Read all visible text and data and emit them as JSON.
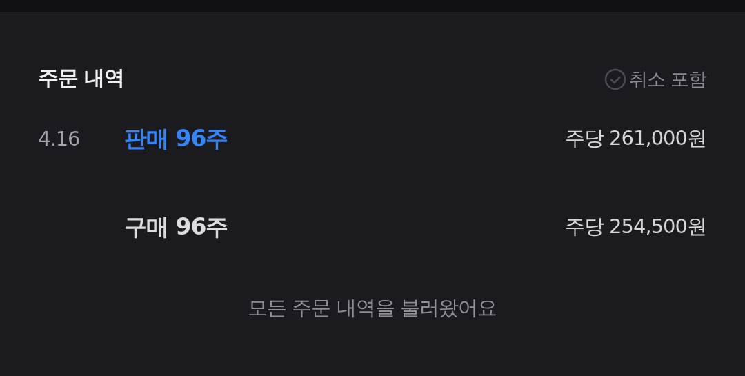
{
  "title": "주문 내역",
  "filter": {
    "label": "취소 포함",
    "checked": false
  },
  "orders": [
    {
      "date": "4.16",
      "kind": "sell",
      "label": "판매 96주",
      "price": "주당 261,000원"
    },
    {
      "kind": "buy",
      "label": "구매 96주",
      "price": "주당 254,500원"
    }
  ],
  "footer": "모든 주문 내역을 불러왔어요"
}
